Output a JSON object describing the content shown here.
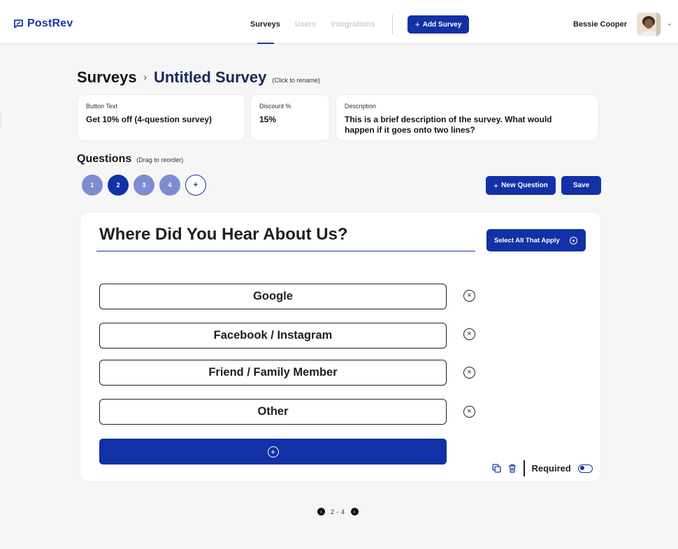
{
  "header": {
    "logo_text": "PostRev",
    "nav": [
      "Surveys",
      "Users",
      "Integrations"
    ],
    "add_survey_label": "Add Survey",
    "user_name": "Bessie Cooper"
  },
  "breadcrumb": {
    "root": "Surveys",
    "title": "Untitled Survey",
    "hint": "(Click to rename)"
  },
  "fields": {
    "button_text": {
      "label": "Button Text",
      "value": "Get 10% off (4-question survey)"
    },
    "discount": {
      "label": "Discount %",
      "value": "15%"
    },
    "description": {
      "label": "Description",
      "value": "This is a brief description of the survey. What would happen if it goes onto two lines?"
    }
  },
  "questions": {
    "heading": "Questions",
    "hint": "(Drag to reorder)",
    "numbers": [
      "1",
      "2",
      "3",
      "4"
    ],
    "active_index": 1,
    "add_symbol": "+",
    "new_question_label": "New Question",
    "save_label": "Save"
  },
  "current_question": {
    "text": "Where Did You Hear About Us?",
    "type_label": "Select All That Apply",
    "options": [
      "Google",
      "Facebook / Instagram",
      "Friend / Family Member",
      "Other"
    ],
    "required_label": "Required",
    "required": false
  },
  "pager": {
    "range": "2 - 4"
  },
  "colors": {
    "accent": "#1231a6",
    "muted_accent": "#7e8cd1",
    "background": "#f6f6f6"
  }
}
